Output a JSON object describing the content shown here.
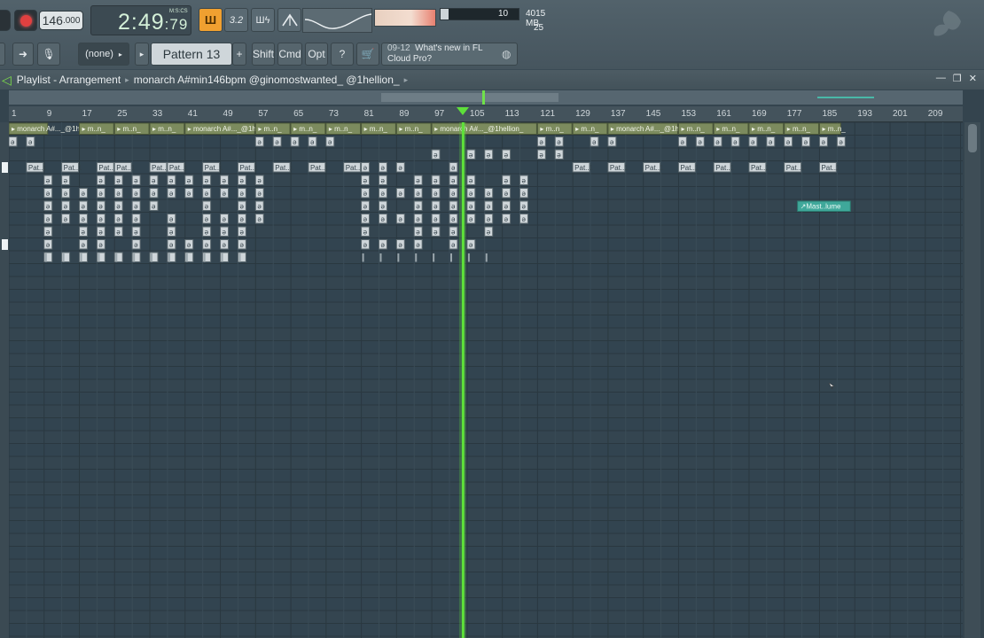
{
  "transport": {
    "tempo_main": "146",
    "tempo_frac": ".000",
    "time": "2:49",
    "time_frac": ":79",
    "time_label": "M:S:CS"
  },
  "toolbar": {
    "pattern_mode_label": "Ш",
    "tool2_label": "3.2",
    "tool3_label": "Шϟ",
    "cpu_value": "10",
    "cpu_percent": 0.1,
    "memory": "4015 MB",
    "polyphony": "25"
  },
  "row2": {
    "snap": "(none)",
    "pattern": "Pattern 13",
    "shift": "Shift",
    "cmd": "Cmd",
    "opt": "Opt",
    "news_date": "09-12",
    "news_title": "What's new in FL",
    "news_sub": "Cloud Pro?"
  },
  "playlist": {
    "title": "Playlist - Arrangement",
    "song": "monarch A#min146bpm @ginomostwanted_ @1hellion_",
    "ruler_ticks": [
      "1",
      "9",
      "17",
      "25",
      "33",
      "41",
      "49",
      "57",
      "65",
      "73",
      "81",
      "89",
      "97",
      "105",
      "113",
      "121",
      "129",
      "137",
      "145",
      "153",
      "161",
      "169",
      "177",
      "185",
      "193",
      "201",
      "209"
    ],
    "playhead_bar": 104,
    "automation_clip": "Mast..lume",
    "audio_clip_labels": [
      "monarch A#..._@1hellion_",
      "m..n_",
      "monarch A#..._@1hellion_"
    ],
    "pattern_labels": [
      "Pat..1",
      "Pat..2",
      "Pat..3"
    ]
  },
  "colors": {
    "playhead": "#5ee03a",
    "clip_audio": "#7c8b5e",
    "clip_pattern": "#cfd6da",
    "automation": "#3fa89a"
  }
}
